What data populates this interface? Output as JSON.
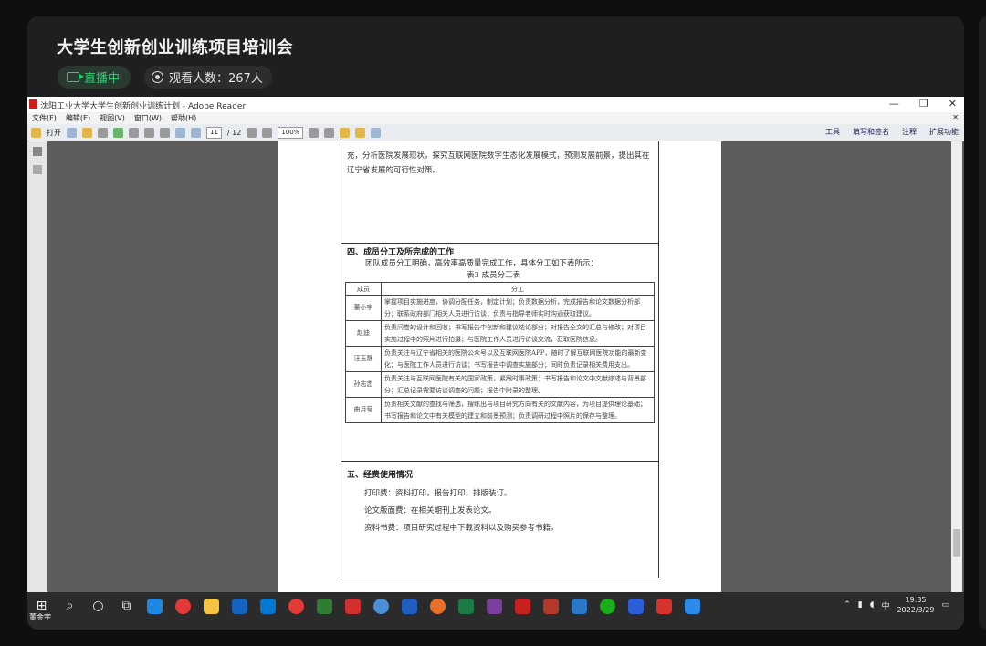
{
  "stream": {
    "title": "大学生创新创业训练项目培训会",
    "live_label": "直播中",
    "viewers_label": "观看人数：267人"
  },
  "reader": {
    "window_title": "沈阳工业大学大学生创新创业训练计划 - Adobe Reader",
    "menu": [
      "文件(F)",
      "编辑(E)",
      "视图(V)",
      "窗口(W)",
      "帮助(H)"
    ],
    "open_label": "打开",
    "page_current": "11",
    "page_total": "/ 12",
    "zoom": "100%",
    "right_tools": [
      "工具",
      "填写和签名",
      "注释",
      "扩展功能"
    ]
  },
  "document": {
    "top_text": "充，分析医院发展现状，探究互联网医院数字生态化发展模式，预测发展前景，提出其在辽宁省发展的可行性对策。",
    "section4_title": "四、成员分工及所完成的工作",
    "section4_intro": "团队成员分工明确，高效率高质量完成工作，具体分工如下表所示：",
    "table_caption": "表3  成员分工表",
    "table_headers": [
      "成员",
      "分工"
    ],
    "table_rows": [
      {
        "name": "董小宇",
        "duty": "掌握项目实施进度，协调分配任务，制定计划；负责数据分析，完成报告和论文数据分析部分；联系政府部门相关人员进行访谈；负责与指导老师实时沟通获取建议。"
      },
      {
        "name": "赵迪",
        "duty": "负责问卷的设计和回收；书写报告中创新和建议结论部分；对报告全文的汇总与修改；对项目实施过程中的照片进行拍摄；与医院工作人员进行访谈交流，获取医院信息。"
      },
      {
        "name": "汪玉静",
        "duty": "负责关注与辽宁省相关的医院公众号以及互联网医院APP，随时了解互联网医院功能的最新变化；与医院工作人员进行访谈；书写报告中调查实施部分；同时负责记录相关费用支出。"
      },
      {
        "name": "孙志恋",
        "duty": "负责关注与互联网医院有关的国家政策，紧跟时事政策；书写报告和论文中文献综述与背景部分；汇总记录需要访谈调查的问题；报告中附录的整理。"
      },
      {
        "name": "曲月莹",
        "duty": "负责相关文献的查找与筛选，搜练出与项目研究方向有关的文献内容，为项目提供理论基础；书写报告和论文中有关模型的建立和前景预测；负责调研过程中照片的保存与整理。"
      }
    ],
    "section5_title": "五、经费使用情况",
    "expenses": [
      "打印费：资料打印，报告打印，排版装订。",
      "论文版面费：在相关期刊上发表论文。",
      "资料书费：项目研究过程中下载资料以及购买参考书籍。"
    ]
  },
  "taskbar": {
    "start_label": "董金宇",
    "ime": "中",
    "time": "19:35",
    "date": "2022/3/29"
  },
  "colors": {
    "panel_bg": "#1f1f21",
    "live_green": "#2ecc71",
    "pdf_red": "#c8201e"
  }
}
